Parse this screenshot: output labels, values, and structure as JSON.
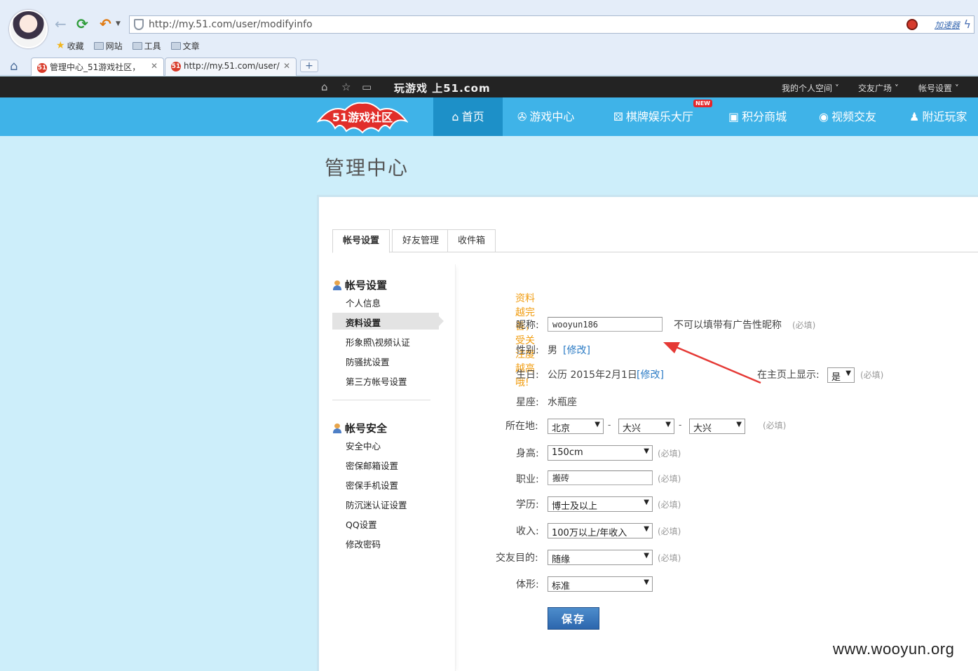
{
  "browser": {
    "url": "http://my.51.com/user/modifyinfo",
    "speed_label": "加速器",
    "bookmarks": [
      "收藏",
      "网站",
      "工具",
      "文章"
    ],
    "tabs": [
      {
        "title": "管理中心_51游戏社区，"
      },
      {
        "title": "http://my.51.com/user/"
      }
    ],
    "new_tab": "+"
  },
  "topbar": {
    "slogan": "玩游戏 上51.com",
    "menus": [
      "我的个人空间 ˅",
      "交友广场 ˅",
      "帐号设置 ˅"
    ]
  },
  "nav": {
    "logo_text": "51游戏社区",
    "new_badge": "NEW",
    "items": [
      {
        "label": "首页",
        "icon": "home-icon"
      },
      {
        "label": "游戏中心",
        "icon": "gamepad-icon"
      },
      {
        "label": "棋牌娱乐大厅",
        "icon": "dice-icon"
      },
      {
        "label": "积分商城",
        "icon": "gift-icon"
      },
      {
        "label": "视频交友",
        "icon": "camera-icon"
      },
      {
        "label": "附近玩家",
        "icon": "people-icon"
      }
    ]
  },
  "page": {
    "title": "管理中心",
    "tabs": [
      "帐号设置",
      "好友管理",
      "收件箱"
    ]
  },
  "sidebar": {
    "sections": [
      {
        "heading": "帐号设置",
        "items": [
          "个人信息",
          "资料设置",
          "形象照\\视频认证",
          "防骚扰设置",
          "第三方帐号设置"
        ]
      },
      {
        "heading": "帐号安全",
        "items": [
          "安全中心",
          "密保邮箱设置",
          "密保手机设置",
          "防沉迷认证设置",
          "QQ设置",
          "修改密码"
        ]
      }
    ]
  },
  "form": {
    "notice": "资料越完善，受关注度越高哦!",
    "required": "(必填)",
    "nickname": {
      "label": "昵称:",
      "value": "wooyun186",
      "hint": "不可以填带有广告性昵称"
    },
    "gender": {
      "label": "性别:",
      "value": "男",
      "edit": "[修改]"
    },
    "birthday": {
      "label": "生日:",
      "value": "公历  2015年2月1日",
      "edit": "[修改]",
      "show_label": "在主页上显示:",
      "show_value": "是"
    },
    "zodiac": {
      "label": "星座:",
      "value": "水瓶座"
    },
    "location": {
      "label": "所在地:",
      "province": "北京",
      "city": "大兴",
      "district": "大兴",
      "sep": "-"
    },
    "height": {
      "label": "身高:",
      "value": "150cm"
    },
    "job": {
      "label": "职业:",
      "value": "搬砖"
    },
    "education": {
      "label": "学历:",
      "value": "博士及以上"
    },
    "income": {
      "label": "收入:",
      "value": "100万以上/年收入"
    },
    "purpose": {
      "label": "交友目的:",
      "value": "随缘"
    },
    "body": {
      "label": "体形:",
      "value": "标准"
    },
    "save_label": "保存"
  },
  "watermark": "www.wooyun.org",
  "colors": {
    "nav_bg": "#3fb3e8",
    "nav_active": "#1d90c8",
    "topbar_bg": "#232323",
    "notice": "#f19d11",
    "link": "#2a7ac4",
    "save_button": "#2c66ad",
    "arrow": "#e53935"
  }
}
